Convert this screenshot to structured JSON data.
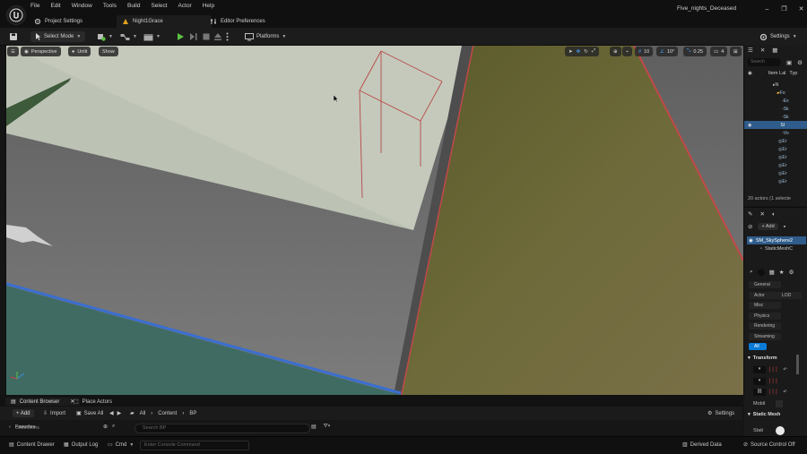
{
  "app": {
    "project_name": "Five_nights_Deceased",
    "menu": [
      "File",
      "Edit",
      "Window",
      "Tools",
      "Build",
      "Select",
      "Actor",
      "Help"
    ],
    "window_controls": [
      "–",
      "❐",
      "✕"
    ]
  },
  "tabs": {
    "project_settings": "Project Settings",
    "level": "Night1Grace",
    "editor_prefs": "Editor Preferences"
  },
  "toolbar": {
    "select_mode": "Select Mode",
    "platforms": "Platforms",
    "settings": "Settings"
  },
  "viewport": {
    "perspective": "Perspective",
    "lit_mode": "Unlit",
    "show": "Show",
    "grid_snap": "10",
    "rotation_snap": "10°",
    "scale_snap": "0.25",
    "camera_speed": "4"
  },
  "outliner": {
    "search_placeholder": "Search",
    "header_label": "Item Lal",
    "header_type": "Typ",
    "actor_count": "20 actors (1 selecte",
    "rows": [
      "N",
      "Fo",
      "Ex",
      "Sk",
      "Sk",
      "SI",
      "Vo",
      "Er",
      "Er",
      "Er",
      "Er",
      "Er",
      "Er"
    ]
  },
  "details": {
    "add": "+ Add",
    "selected_actor": "SM_SkySphere2",
    "component": "StaticMeshC",
    "categories": [
      "General",
      "Actor",
      "LOD",
      "Misc",
      "Physics",
      "Rendering",
      "Streaming",
      "All"
    ],
    "transform_header": "Transform",
    "mobility_label": "Mobil",
    "static_mesh_header": "Static Mesh",
    "static_mesh_field": "Stati"
  },
  "content_browser": {
    "tab_label": "Content Browser",
    "place_actors": "Place Actors",
    "add": "+ Add",
    "import": "Import",
    "save_all": "Save All",
    "breadcrumb": [
      "All",
      "Content",
      "BP"
    ],
    "settings": "Settings",
    "search_placeholder": "Search BP",
    "favorites": "Favorites",
    "collections": "Collections"
  },
  "statusbar": {
    "content_drawer": "Content Drawer",
    "output_log": "Output Log",
    "cmd": "Cmd",
    "console_placeholder": "Enter Console Command",
    "derived_data": "Derived Data",
    "source_control": "Source Control Off"
  },
  "colors": {
    "accent_blue": "#0a7bd8",
    "play_green": "#5cc242",
    "selection_red": "#d04040",
    "ui_dark": "#1c1c1c"
  }
}
